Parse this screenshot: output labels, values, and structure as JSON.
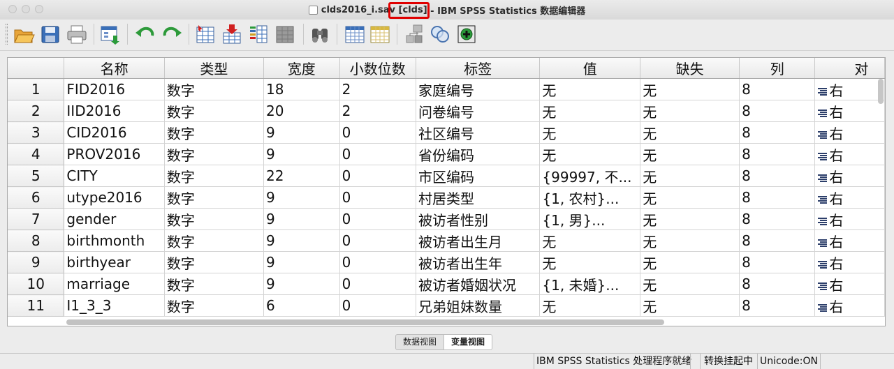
{
  "window": {
    "title_filename": "clds2016_i.sav",
    "title_dataset": "[clds]",
    "title_app": "- IBM SPSS Statistics 数据编辑器"
  },
  "toolbar": {
    "buttons": [
      "open-icon",
      "save-icon",
      "print-icon",
      "dialog-recall-icon",
      "undo-icon",
      "redo-icon",
      "goto-case-icon",
      "goto-variable-icon",
      "variables-icon",
      "run-descriptives-icon",
      "find-icon",
      "insert-cases-icon",
      "insert-variable-icon",
      "split-file-icon",
      "weight-cases-icon",
      "select-cases-icon",
      "value-labels-icon",
      "use-sets-icon"
    ]
  },
  "grid": {
    "columns": [
      "名称",
      "类型",
      "宽度",
      "小数位数",
      "标签",
      "值",
      "缺失",
      "列",
      "对"
    ],
    "rows": [
      {
        "num": "1",
        "name": "FID2016",
        "type": "数字",
        "width": "18",
        "decimals": "2",
        "label": "家庭编号",
        "values": "无",
        "missing": "无",
        "columns": "8",
        "align": "右"
      },
      {
        "num": "2",
        "name": "IID2016",
        "type": "数字",
        "width": "20",
        "decimals": "2",
        "label": "问卷编号",
        "values": "无",
        "missing": "无",
        "columns": "8",
        "align": "右"
      },
      {
        "num": "3",
        "name": "CID2016",
        "type": "数字",
        "width": "9",
        "decimals": "0",
        "label": "社区编号",
        "values": "无",
        "missing": "无",
        "columns": "8",
        "align": "右"
      },
      {
        "num": "4",
        "name": "PROV2016",
        "type": "数字",
        "width": "9",
        "decimals": "0",
        "label": "省份编码",
        "values": "无",
        "missing": "无",
        "columns": "8",
        "align": "右"
      },
      {
        "num": "5",
        "name": "CITY",
        "type": "数字",
        "width": "22",
        "decimals": "0",
        "label": "市区编码",
        "values": "{99997, 不...",
        "missing": "无",
        "columns": "8",
        "align": "右"
      },
      {
        "num": "6",
        "name": "utype2016",
        "type": "数字",
        "width": "9",
        "decimals": "0",
        "label": "村居类型",
        "values": "{1, 农村}...",
        "missing": "无",
        "columns": "8",
        "align": "右"
      },
      {
        "num": "7",
        "name": "gender",
        "type": "数字",
        "width": "9",
        "decimals": "0",
        "label": "被访者性别",
        "values": "{1, 男}...",
        "missing": "无",
        "columns": "8",
        "align": "右"
      },
      {
        "num": "8",
        "name": "birthmonth",
        "type": "数字",
        "width": "9",
        "decimals": "0",
        "label": "被访者出生月",
        "values": "无",
        "missing": "无",
        "columns": "8",
        "align": "右"
      },
      {
        "num": "9",
        "name": "birthyear",
        "type": "数字",
        "width": "9",
        "decimals": "0",
        "label": "被访者出生年",
        "values": "无",
        "missing": "无",
        "columns": "8",
        "align": "右"
      },
      {
        "num": "10",
        "name": "marriage",
        "type": "数字",
        "width": "9",
        "decimals": "0",
        "label": "被访者婚姻状况",
        "values": "{1, 未婚}...",
        "missing": "无",
        "columns": "8",
        "align": "右"
      },
      {
        "num": "11",
        "name": "I1_3_3",
        "type": "数字",
        "width": "6",
        "decimals": "0",
        "label": "兄弟姐妹数量",
        "values": "无",
        "missing": "无",
        "columns": "8",
        "align": "右"
      }
    ]
  },
  "tabs": {
    "data_view": "数据视图",
    "variable_view": "变量视图"
  },
  "status": {
    "processor": "IBM SPSS Statistics 处理程序就绪",
    "suspend": "转换挂起中",
    "unicode": "Unicode:ON"
  },
  "colors": {
    "highlight": "#e00000"
  }
}
